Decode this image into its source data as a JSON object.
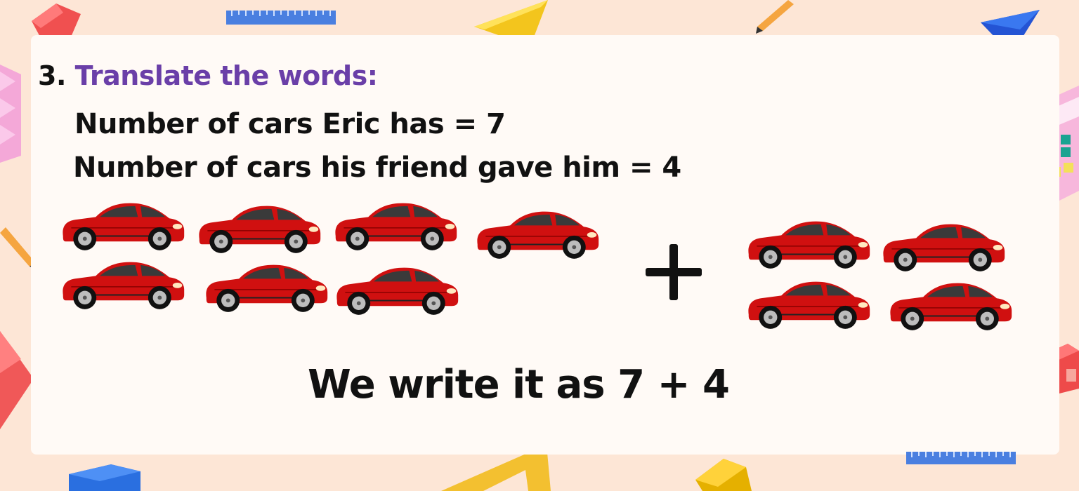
{
  "problem": {
    "number": "3.",
    "heading": "Translate the words:",
    "fact1": "Number of cars Eric has = 7",
    "fact2": "Number of cars his friend gave him = 4",
    "operator_icon": "plus-icon",
    "conclusion": "We write it as 7 + 4"
  },
  "groups": [
    {
      "name": "eric-cars",
      "count": 7,
      "icon": "red-car-icon"
    },
    {
      "name": "friend-cars",
      "count": 4,
      "icon": "red-car-icon"
    }
  ],
  "colors": {
    "background": "#fde6d6",
    "card": "#fffaf6",
    "heading_accent": "#6a3fa8",
    "car_body": "#d01010",
    "text": "#111111"
  },
  "decorations": [
    "ruler-icon",
    "yellow-triangle-icon",
    "pencil-icon",
    "blue-prism-icon",
    "calculator-icon",
    "pink-cube-icon",
    "red-cube-icon",
    "blue-cube-icon",
    "set-square-icon",
    "yellow-cube-icon"
  ]
}
